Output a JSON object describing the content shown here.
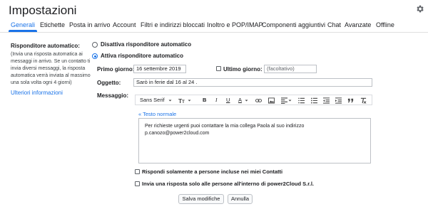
{
  "header": {
    "title": "Impostazioni",
    "settings_icon": "gear-icon"
  },
  "tabs": [
    {
      "label": "Generali",
      "active": true
    },
    {
      "label": "Etichette"
    },
    {
      "label": "Posta in arrivo"
    },
    {
      "label": "Account"
    },
    {
      "label": "Filtri e indirizzi bloccati"
    },
    {
      "label": "Inoltro e POP/IMAP"
    },
    {
      "label": "Componenti aggiuntivi"
    },
    {
      "label": "Chat"
    },
    {
      "label": "Avanzate"
    },
    {
      "label": "Offline"
    }
  ],
  "autoreply": {
    "section_label": "Risponditore automatico:",
    "help_lines": [
      "(Invia una risposta automatica ai",
      "messaggi in arrivo. Se un contatto ti",
      "invia diversi messaggi, la risposta",
      "automatica verrà inviata al massimo",
      "una sola volta ogni 4 giorni)"
    ],
    "learn_more": "Ulteriori informazioni",
    "option_off": "Disattiva risponditore automatico",
    "option_on": "Attiva risponditore automatico",
    "selected": "on",
    "first_day_label": "Primo giorno:",
    "first_day_value": "16 settembre 2019",
    "last_day_label": "Ultimo giorno:",
    "last_day_placeholder": "(facoltativo)",
    "subject_label": "Oggetto:",
    "subject_value": "Sarò in ferie dal 16 al 24 .",
    "message_label": "Messaggio:",
    "toolbar": {
      "font": "Sans Serif",
      "font_size_icon": "text-size-icon",
      "bold": "B",
      "italic": "I",
      "underline": "U",
      "text_color": "A"
    },
    "rich_text_link": "« Testo normale",
    "message_lines": [
      "Per richieste urgenti puoi contattare la mia collega Paola al suo indirizzo",
      "p.canozo@power2cloud.com"
    ],
    "contacts_only_label": "Rispondi solamente a persone incluse nei miei Contatti",
    "org_only_label": "Invia una risposta solo alle persone all'interno di power2Cloud S.r.l."
  },
  "footer": {
    "save": "Salva modifiche",
    "cancel": "Annulla"
  },
  "colors": {
    "accent": "#1a73e8",
    "text": "#202124",
    "border": "#bdc1c6"
  }
}
